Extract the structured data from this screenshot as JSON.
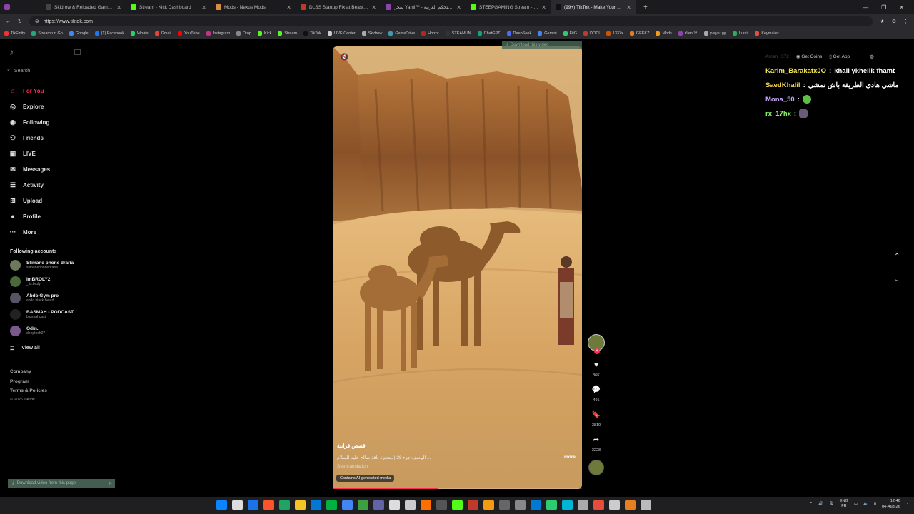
{
  "browser": {
    "tabs": [
      {
        "title": "Skidrow & Reloaded Games – Do",
        "color": "#444",
        "active": false
      },
      {
        "title": "Stream - Kick Dashboard",
        "color": "#53fc18",
        "active": false
      },
      {
        "title": "Mods - Nexus Mods",
        "color": "#d98f40",
        "active": false
      },
      {
        "title": "DLSS Startup Fix at Beast of Reinc",
        "color": "#c0392b",
        "active": false
      },
      {
        "title": "سحر Yaml™ - لوحة التحكم العربية",
        "color": "#8e44ad",
        "active": false
      },
      {
        "title": "STEEPGAMING Stream - Watc",
        "color": "#53fc18",
        "active": false
      },
      {
        "title": "(99+) TikTok - Make Your Day",
        "color": "#111",
        "active": true
      }
    ],
    "url": "https://www.tiktok.com",
    "bookmarks": [
      "TikFinity",
      "Streamrun Go",
      "Google",
      "(1) Facebook",
      "Whats",
      "Gmail",
      "YouTube",
      "Instagram",
      "Drop",
      "Kick",
      "Stream",
      "TikTok",
      "LIVE Center",
      "Skidrow",
      "GameDrive",
      "Horror",
      "STEAMUN",
      "ChatGPT",
      "DeepSeek",
      "Gemini",
      "FitG",
      "DODI",
      "1337x",
      "GEEKZ",
      "Mods",
      "Yaml™",
      "player.gg",
      "Lurkit",
      "Keymailer"
    ]
  },
  "sidebar": {
    "search_placeholder": "Search",
    "nav": [
      {
        "label": "For You",
        "icon": "home-icon",
        "glyph": "⌂",
        "active": true
      },
      {
        "label": "Explore",
        "icon": "compass-icon",
        "glyph": "◎",
        "active": false
      },
      {
        "label": "Following",
        "icon": "following-icon",
        "glyph": "◉",
        "active": false
      },
      {
        "label": "Friends",
        "icon": "friends-icon",
        "glyph": "⚇",
        "active": false
      },
      {
        "label": "LIVE",
        "icon": "live-icon",
        "glyph": "▣",
        "active": false
      },
      {
        "label": "Messages",
        "icon": "messages-icon",
        "glyph": "✉",
        "active": false
      },
      {
        "label": "Activity",
        "icon": "activity-icon",
        "glyph": "☰",
        "active": false
      },
      {
        "label": "Upload",
        "icon": "upload-icon",
        "glyph": "⊞",
        "active": false
      },
      {
        "label": "Profile",
        "icon": "profile-icon",
        "glyph": "●",
        "active": false
      },
      {
        "label": "More",
        "icon": "more-icon",
        "glyph": "···",
        "active": false
      }
    ],
    "following_header": "Following accounts",
    "accounts": [
      {
        "name": "Slimane phone draria",
        "handle": "slimanephonedraria"
      },
      {
        "name": "imBROLY2",
        "handle": "_iis.broly"
      },
      {
        "name": "Abdo Gym pro",
        "handle": "abdo.black.beard"
      },
      {
        "name": "BASMAH - PODCAST",
        "handle": "basmahcast"
      },
      {
        "name": "Odin.",
        "handle": "deeptech07"
      }
    ],
    "view_all": "View all",
    "footer": [
      "Company",
      "Program",
      "Terms & Policies"
    ],
    "copyright": "© 2026 TikTok"
  },
  "video": {
    "download_top": "Download this video",
    "caption_title": "قصص قرآنية",
    "caption_desc": "الوصف:جزء 28 | معجزة ناقة صالح عليه السلام ...",
    "more_label": "more",
    "see_translation": "See translation",
    "ai_badge": "Contains AI-generated media",
    "progress_fraction": 0.42
  },
  "actions": {
    "likes": "36K",
    "comments": "491",
    "saves": "3810",
    "shares": "2228"
  },
  "topright": {
    "faded_user": "Amani_372",
    "get_coins": "Get Coins",
    "get_app": "Get App"
  },
  "chat": [
    {
      "user": "Karim_BarakatxJO",
      "msg": "khali ykhelik fhamt",
      "emote": false
    },
    {
      "user": "SaedKhalil",
      "msg": "ماشي هادي الطريقة باش تمشي",
      "emote": false
    },
    {
      "user": "Mona_50",
      "msg": "",
      "emote": true
    },
    {
      "user": "rx_17hx",
      "msg": "",
      "emote": true
    }
  ],
  "download_bottom": "Download video from this page",
  "taskbar": {
    "lang": "ENG",
    "lang2": "FR",
    "time": "12:46",
    "date": "04-Aug-26",
    "colors": [
      "#0a84ff",
      "#ddd",
      "#1a73e8",
      "#fb542b",
      "#1fa463",
      "#f3c623",
      "#0078d4",
      "#00b140",
      "#4285f4",
      "#3c9f40",
      "#6264a7",
      "#ddd",
      "#ccc",
      "#ff6f00",
      "#555",
      "#53fc18",
      "#c0392b",
      "#f39c12",
      "#666",
      "#888",
      "#0078d4",
      "#2ecc71",
      "#00b4d8",
      "#aaa",
      "#e74c3c",
      "#ccc",
      "#e67e22",
      "#bbb"
    ]
  }
}
